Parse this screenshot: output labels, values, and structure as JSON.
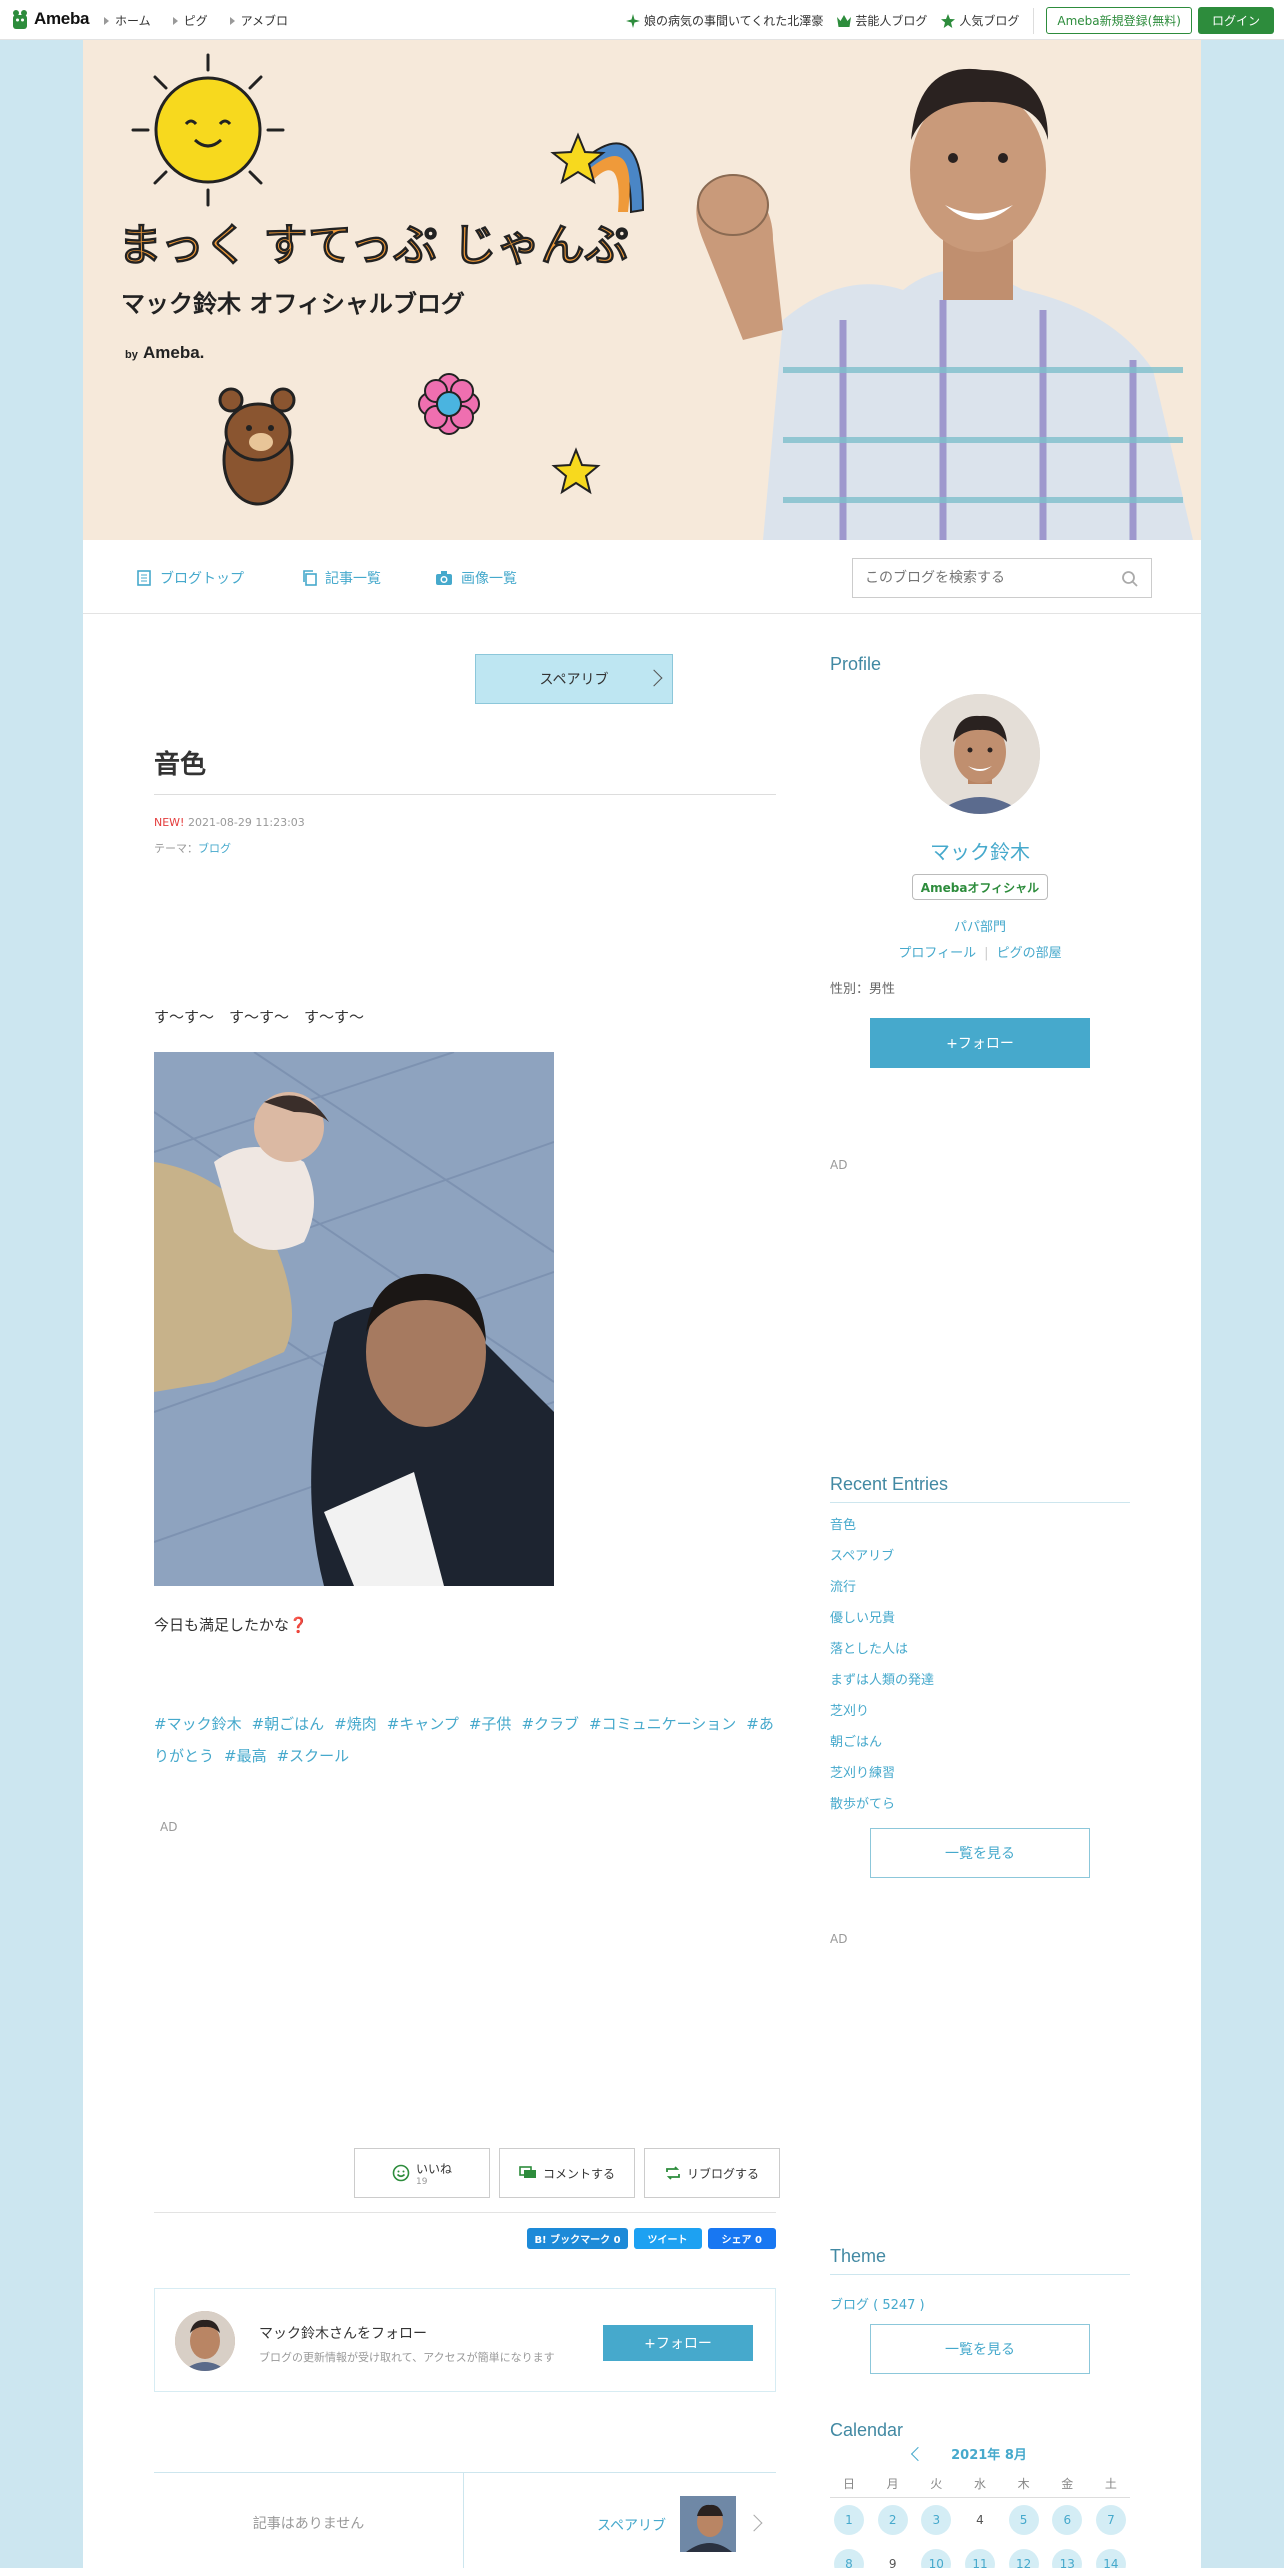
{
  "global_header": {
    "logo_text": "Ameba",
    "nav": [
      "ホーム",
      "ピグ",
      "アメブロ"
    ],
    "featured_link": "娘の病気の事間いてくれた北澤豪",
    "celeb_blog": "芸能人ブログ",
    "popular_blog": "人気ブログ",
    "register": "Ameba新規登録(無料)",
    "login": "ログイン"
  },
  "blog_header": {
    "title_line": "まっく すてっぷ じゃんぷ",
    "subtitle": "マック鈴木 オフィシャルブログ",
    "by": "by",
    "brand": "Ameba."
  },
  "blog_nav": {
    "items": [
      "ブログトップ",
      "記事一覧",
      "画像一覧"
    ],
    "search_placeholder": "このブログを検索する"
  },
  "article": {
    "reblog_top": "スペアリブ",
    "title": "音色",
    "new_badge": "NEW!",
    "datetime": "2021-08-29 11:23:03",
    "theme_label": "テーマ：",
    "theme_value": "ブログ",
    "body1": "す〜す〜　す〜す〜　す〜す〜",
    "body2": "今日も満足したかな",
    "body2_mark": "❓",
    "tags": [
      "#マック鈴木",
      "#朝ごはん",
      "#焼肉",
      "#キャンプ",
      "#子供",
      "#クラブ",
      "#コミュニケーション",
      "#ありがとう",
      "#最高",
      "#スクール"
    ],
    "ad_label": "AD",
    "like_label": "いいね",
    "like_count": "19",
    "comment_label": "コメントする",
    "reblog_label": "リブログする",
    "bookmark": "B! ブックマーク  0",
    "tweet": "ツイート",
    "share": "シェア  0",
    "follow_title": "マック鈴木さんをフォロー",
    "follow_desc": "ブログの更新情報が受け取れて、アクセスが簡単になります",
    "follow_button": "+フォロー",
    "prev_none": "記事はありません",
    "next_label": "スペアリブ"
  },
  "sidebar": {
    "profile_heading": "Profile",
    "name": "マック鈴木",
    "badge": "Amebaオフィシャル",
    "category": "パパ部門",
    "profile_link": "プロフィール",
    "pig_link": "ピグの部屋",
    "gender": "性別：男性",
    "follow_button": "+フォロー",
    "ad_label": "AD",
    "recent_heading": "Recent Entries",
    "recent": [
      "音色",
      "スペアリブ",
      "流行",
      "優しい兄貴",
      "落とした人は",
      "まずは人類の発達",
      "芝刈り",
      "朝ごはん",
      "芝刈り練習",
      "散歩がてら"
    ],
    "more_label": "一覧を見る",
    "theme_heading": "Theme",
    "theme_item": "ブログ ( 5247 )",
    "calendar_heading": "Calendar",
    "calendar_month": "2021年 8月",
    "calendar_dow": [
      "日",
      "月",
      "火",
      "水",
      "木",
      "金",
      "土"
    ],
    "calendar_rows": [
      [
        "1",
        "2",
        "3",
        "4",
        "5",
        "6",
        "7"
      ],
      [
        "8",
        "9",
        "10",
        "11",
        "12",
        "13",
        "14"
      ]
    ],
    "calendar_active": [
      [
        "1",
        "2",
        "3",
        "5",
        "6",
        "7"
      ],
      [
        "8",
        "10",
        "11",
        "12",
        "13",
        "14"
      ]
    ]
  },
  "colors": {
    "accent": "#46a9cc",
    "brand_green": "#2d8c3c",
    "page_bg": "#cce6f0"
  }
}
